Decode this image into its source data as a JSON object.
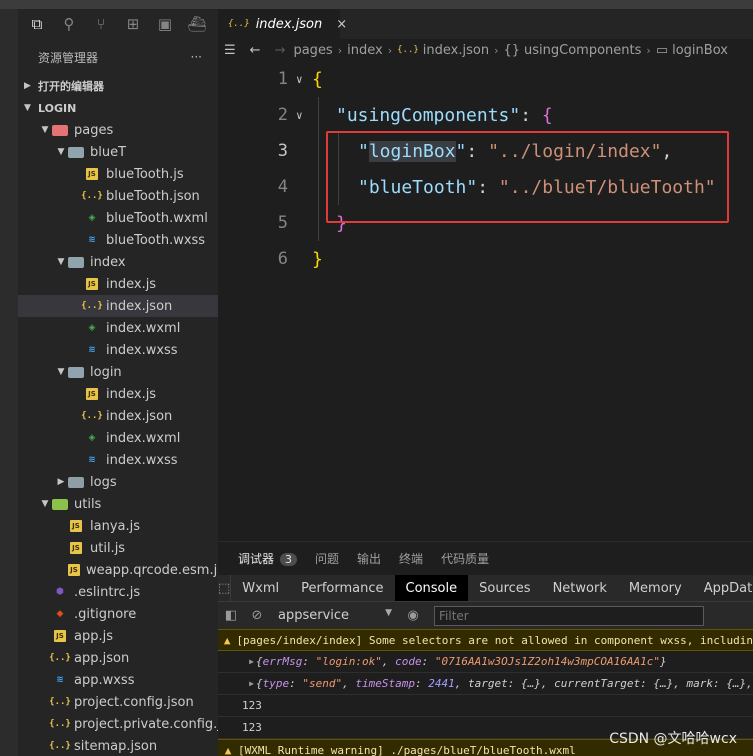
{
  "explorer": {
    "title": "资源管理器",
    "more": "···",
    "open_editors": "打开的编辑器",
    "project": "LOGIN",
    "tree": [
      {
        "label": "pages",
        "type": "folder-pages",
        "depth": 1,
        "open": true
      },
      {
        "label": "blueT",
        "type": "folder",
        "depth": 2,
        "open": true
      },
      {
        "label": "blueTooth.js",
        "type": "js",
        "depth": 3
      },
      {
        "label": "blueTooth.json",
        "type": "json",
        "depth": 3
      },
      {
        "label": "blueTooth.wxml",
        "type": "wxml",
        "depth": 3
      },
      {
        "label": "blueTooth.wxss",
        "type": "wxss",
        "depth": 3
      },
      {
        "label": "index",
        "type": "folder",
        "depth": 2,
        "open": true
      },
      {
        "label": "index.js",
        "type": "js",
        "depth": 3
      },
      {
        "label": "index.json",
        "type": "json",
        "depth": 3,
        "selected": true
      },
      {
        "label": "index.wxml",
        "type": "wxml",
        "depth": 3
      },
      {
        "label": "index.wxss",
        "type": "wxss",
        "depth": 3
      },
      {
        "label": "login",
        "type": "folder",
        "depth": 2,
        "open": true
      },
      {
        "label": "index.js",
        "type": "js",
        "depth": 3
      },
      {
        "label": "index.json",
        "type": "json",
        "depth": 3
      },
      {
        "label": "index.wxml",
        "type": "wxml",
        "depth": 3
      },
      {
        "label": "index.wxss",
        "type": "wxss",
        "depth": 3
      },
      {
        "label": "logs",
        "type": "folder-logs",
        "depth": 2,
        "open": false
      },
      {
        "label": "utils",
        "type": "folder-utils",
        "depth": 1,
        "open": true
      },
      {
        "label": "lanya.js",
        "type": "js",
        "depth": 2
      },
      {
        "label": "util.js",
        "type": "js",
        "depth": 2
      },
      {
        "label": "weapp.qrcode.esm.js",
        "type": "js",
        "depth": 2
      },
      {
        "label": ".eslintrc.js",
        "type": "eslint",
        "depth": 1
      },
      {
        "label": ".gitignore",
        "type": "git",
        "depth": 1
      },
      {
        "label": "app.js",
        "type": "js",
        "depth": 1
      },
      {
        "label": "app.json",
        "type": "json",
        "depth": 1
      },
      {
        "label": "app.wxss",
        "type": "wxss",
        "depth": 1
      },
      {
        "label": "project.config.json",
        "type": "json",
        "depth": 1
      },
      {
        "label": "project.private.config.js...",
        "type": "json",
        "depth": 1
      },
      {
        "label": "sitemap.json",
        "type": "json",
        "depth": 1
      }
    ]
  },
  "editor": {
    "tab_icon": "{..}",
    "tab_title": "index.json",
    "tab_close": "×",
    "breadcrumb": [
      "pages",
      "index",
      "{..}",
      "index.json",
      "{}",
      "usingComponents",
      "▭",
      "loginBox"
    ],
    "code": {
      "line_numbers": [
        "1",
        "2",
        "3",
        "4",
        "5",
        "6"
      ],
      "open_brace": "{",
      "using_key": "\"usingComponents\"",
      "colon": ": ",
      "inner_open": "{",
      "login_quote_open": "\"",
      "login_key": "loginBox",
      "login_quote_close": "\"",
      "login_value": "\"../login/index\"",
      "comma": ",",
      "bt_key": "\"blueTooth\"",
      "bt_value": "\"../blueT/blueTooth\"",
      "inner_close": "}",
      "close_brace": "}"
    }
  },
  "panel": {
    "tabs": [
      "调试器",
      "问题",
      "输出",
      "终端",
      "代码质量"
    ],
    "badge": "3",
    "devtools_tabs": [
      "Wxml",
      "Performance",
      "Console",
      "Sources",
      "Network",
      "Memory",
      "AppData"
    ],
    "active_devtool": "Console",
    "context": "appservice",
    "context_arrow": "▼",
    "filter_placeholder": "Filter",
    "console": {
      "warn1": "[pages/index/index] Some selectors are not allowed in component wxss, includin",
      "obj1_pre": "{",
      "obj1_k1": "errMsg",
      "obj1_v1": "\"login:ok\"",
      "obj1_k2": "code",
      "obj1_v2": "\"0716AA1w3OJs1Z2oh14w3mpCOA16AA1c\"",
      "obj1_post": "}",
      "obj2_pre": "{",
      "obj2_k1": "type",
      "obj2_v1": "\"send\"",
      "obj2_k2": "timeStamp",
      "obj2_v2": "2441",
      "obj2_rest": "target: {…}, currentTarget: {…}, mark: {…},",
      "num1": "123",
      "num2": "123",
      "warn2": "[WXML Runtime warning] ./pages/blueT/blueTooth.wxml"
    }
  },
  "watermark": "CSDN @文哈哈wcx"
}
